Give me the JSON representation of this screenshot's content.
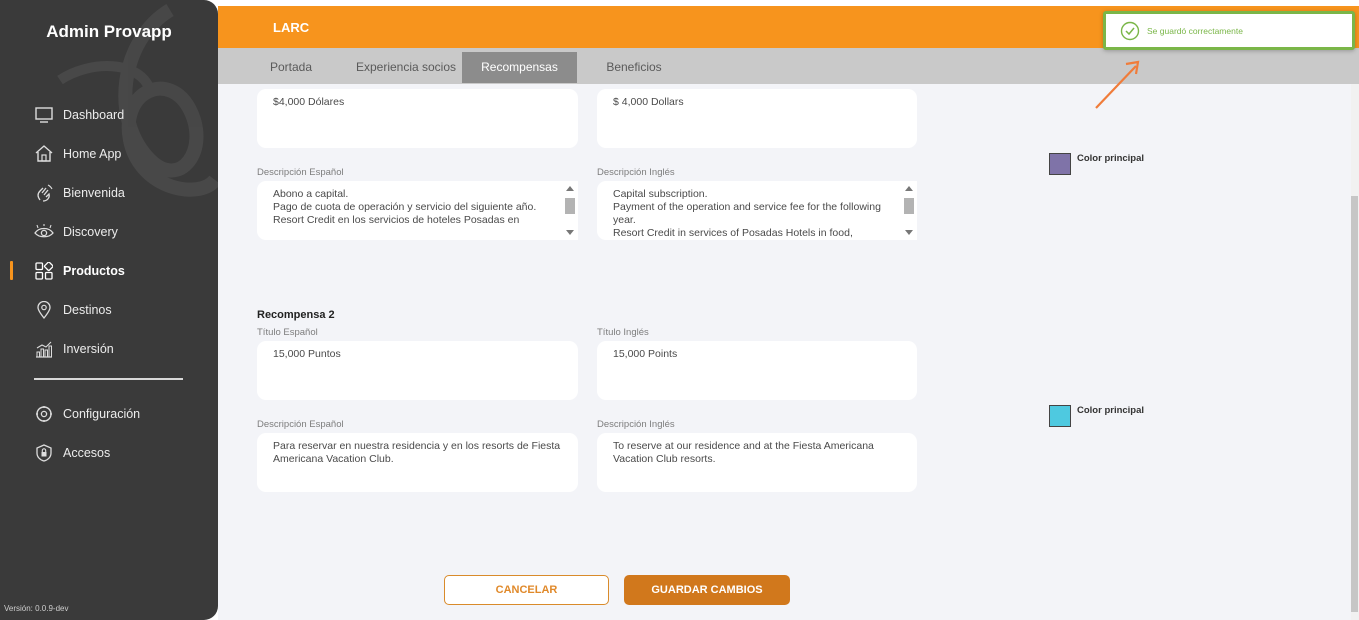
{
  "sidebar": {
    "brand": "Admin Provapp",
    "items": [
      {
        "label": "Dashboard",
        "icon": "monitor-icon"
      },
      {
        "label": "Home App",
        "icon": "home-icon"
      },
      {
        "label": "Bienvenida",
        "icon": "wave-hand-icon"
      },
      {
        "label": "Discovery",
        "icon": "eye-icon"
      },
      {
        "label": "Productos",
        "icon": "grid-icon",
        "active": true
      },
      {
        "label": "Destinos",
        "icon": "location-pin-icon"
      },
      {
        "label": "Inversión",
        "icon": "bar-chart-icon"
      }
    ],
    "secondary": [
      {
        "label": "Configuración",
        "icon": "gear-icon"
      },
      {
        "label": "Accesos",
        "icon": "shield-lock-icon"
      }
    ],
    "version": "Versión: 0.0.9-dev"
  },
  "header": {
    "title": "LARC",
    "tabs": [
      "Portada",
      "Experiencia socios",
      "Recompensas",
      "Beneficios"
    ],
    "active_tab": "Recompensas"
  },
  "reward1": {
    "title_es_value": "$4,000 Dólares",
    "title_en_value": "$ 4,000 Dollars",
    "desc_es_label": "Descripción Español",
    "desc_en_label": "Descripción Inglés",
    "desc_es_value": "Abono a capital.\nPago de cuota de operación y servicio del siguiente año.\nResort Credit en los servicios de hoteles Posadas en",
    "desc_en_value": "Capital subscription.\nPayment of the operation and service fee for the following year.\nResort Credit in services of Posadas Hotels in food,",
    "color_label": "Color principal",
    "color": "#7f73a8"
  },
  "reward2": {
    "heading": "Recompensa 2",
    "title_es_label": "Título Español",
    "title_en_label": "Título Inglés",
    "title_es_value": "15,000 Puntos",
    "title_en_value": "15,000 Points",
    "desc_es_label": "Descripción Español",
    "desc_en_label": "Descripción Inglés",
    "desc_es_value": "Para reservar en nuestra residencia y en los resorts de Fiesta Americana Vacation Club.",
    "desc_en_value": "To reserve at our residence and at the Fiesta Americana Vacation Club resorts.",
    "color_label": "Color principal",
    "color": "#4ec9e0"
  },
  "actions": {
    "cancel": "CANCELAR",
    "save": "GUARDAR CAMBIOS"
  },
  "toast": {
    "message": "Se guardó correctamente",
    "icon": "check-circle-icon"
  },
  "colors": {
    "accent": "#f7941d",
    "sidebar_bg": "#3a3a3a",
    "success": "#7ab648"
  }
}
